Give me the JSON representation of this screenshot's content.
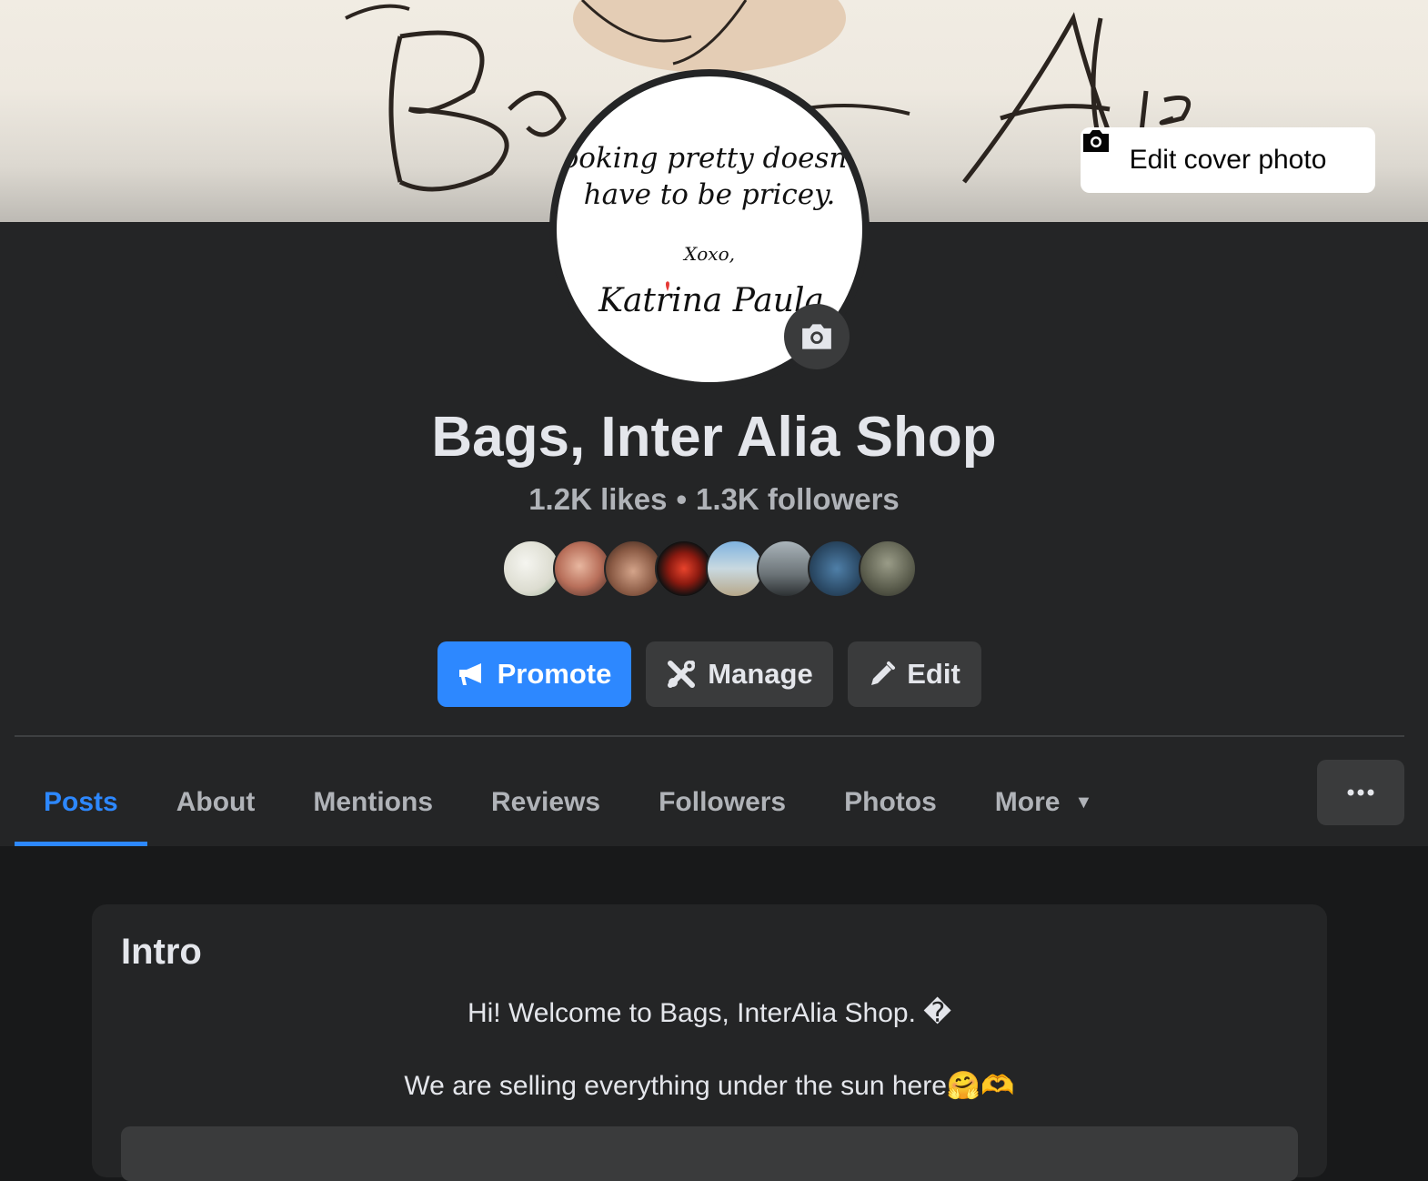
{
  "cover": {
    "edit_label": "Edit cover photo",
    "cover_text": "Bags Inter Alia"
  },
  "avatar": {
    "line1": "looking pretty doesn't",
    "line2": "have to be pricey.",
    "line3": "Xoxo,",
    "line4": "Katrina Paula"
  },
  "page": {
    "title": "Bags, Inter Alia Shop",
    "likes": "1.2K likes",
    "separator": "•",
    "followers": "1.3K followers"
  },
  "actions": {
    "promote": "Promote",
    "manage": "Manage",
    "edit": "Edit"
  },
  "tabs": [
    {
      "label": "Posts",
      "active": true
    },
    {
      "label": "About"
    },
    {
      "label": "Mentions"
    },
    {
      "label": "Reviews"
    },
    {
      "label": "Followers"
    },
    {
      "label": "Photos"
    },
    {
      "label": "More"
    }
  ],
  "intro": {
    "title": "Intro",
    "line1": "Hi! Welcome to Bags, InterAlia Shop. �",
    "line2": "We are selling everything under the sun here🤗🫶"
  },
  "colors": {
    "accent": "#2d88ff",
    "surface": "#242526",
    "background": "#18191a",
    "button": "#3a3b3c"
  }
}
